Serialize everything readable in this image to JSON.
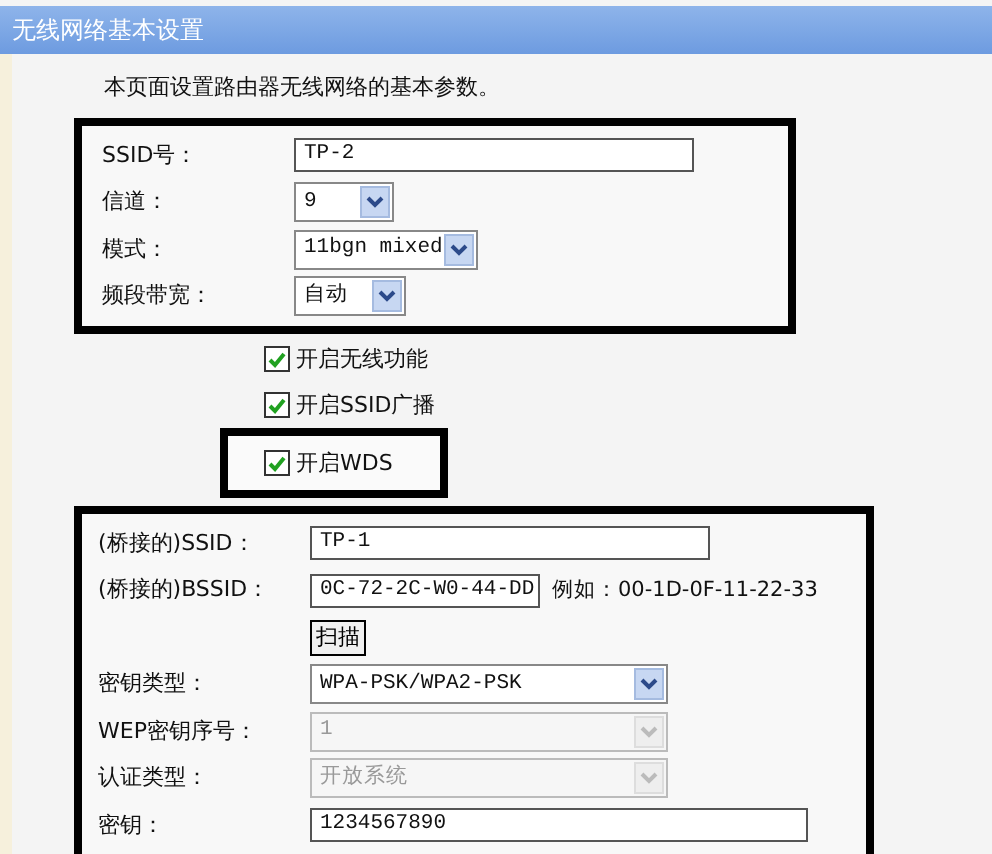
{
  "window": {
    "title": "无线网络基本设置"
  },
  "description": "本页面设置路由器无线网络的基本参数。",
  "basic": {
    "highlighted": true,
    "fields": [
      {
        "kind": "text",
        "label": "SSID号：",
        "value": "TP-2"
      },
      {
        "kind": "select",
        "label": "信道：",
        "value": "9",
        "disabled": false
      },
      {
        "kind": "select",
        "label": "模式：",
        "value": "11bgn mixed",
        "disabled": false
      },
      {
        "kind": "select",
        "label": "频段带宽：",
        "value": "自动",
        "disabled": false
      }
    ]
  },
  "options": [
    {
      "label": "开启无线功能",
      "checked": true,
      "highlighted": false
    },
    {
      "label": "开启SSID广播",
      "checked": true,
      "highlighted": false
    },
    {
      "label": "开启WDS",
      "checked": true,
      "highlighted": true
    }
  ],
  "bridge": {
    "highlighted": true,
    "fields": [
      {
        "kind": "text",
        "label": "(桥接的)SSID：",
        "value": "TP-1"
      },
      {
        "kind": "text",
        "label": "(桥接的)BSSID：",
        "value": "0C-72-2C-W0-44-DD",
        "hint": "例如：00-1D-0F-11-22-33"
      },
      {
        "kind": "button",
        "value": "扫描"
      },
      {
        "kind": "select",
        "label": "密钥类型：",
        "value": "WPA-PSK/WPA2-PSK",
        "disabled": false
      },
      {
        "kind": "select",
        "label": "WEP密钥序号：",
        "value": "1",
        "disabled": true
      },
      {
        "kind": "select",
        "label": "认证类型：",
        "value": "开放系统",
        "disabled": true
      },
      {
        "kind": "text",
        "label": "密钥：",
        "value": "1234567890"
      }
    ]
  }
}
